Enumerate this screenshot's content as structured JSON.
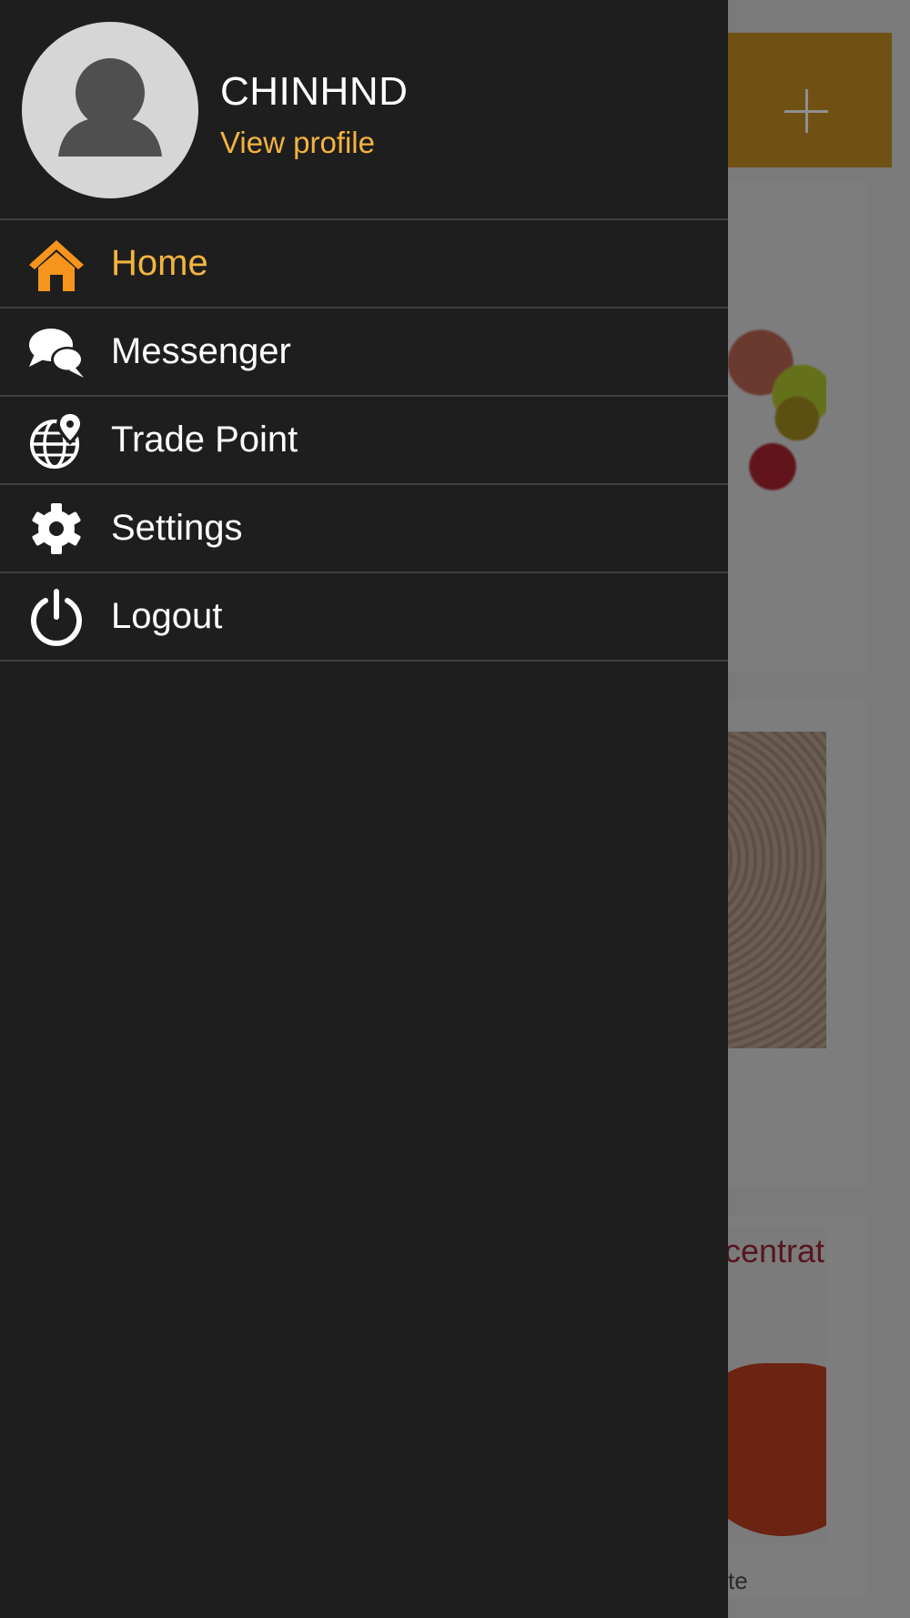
{
  "profile": {
    "username": "CHINHND",
    "view_profile_label": "View profile",
    "avatar_icon": "person-icon"
  },
  "menu": {
    "items": [
      {
        "label": "Home",
        "icon": "home-icon",
        "active": true
      },
      {
        "label": "Messenger",
        "icon": "chat-bubbles-icon",
        "active": false
      },
      {
        "label": "Trade Point",
        "icon": "globe-pin-icon",
        "active": false
      },
      {
        "label": "Settings",
        "icon": "gear-icon",
        "active": false
      },
      {
        "label": "Logout",
        "icon": "power-icon",
        "active": false
      }
    ]
  },
  "background": {
    "header_action_icon": "plus-icon",
    "cards": [
      {
        "image": "fruits",
        "caption": ""
      },
      {
        "image": "peanuts",
        "caption": ""
      },
      {
        "image": "tomato-concentrate",
        "image_text": "centrat",
        "caption": "te"
      }
    ]
  },
  "colors": {
    "drawer_bg": "#1e1e1e",
    "accent": "#f3b43f",
    "home_icon": "#f7941d",
    "divider": "#3f3f3f",
    "header_bg": "#6f5114"
  }
}
